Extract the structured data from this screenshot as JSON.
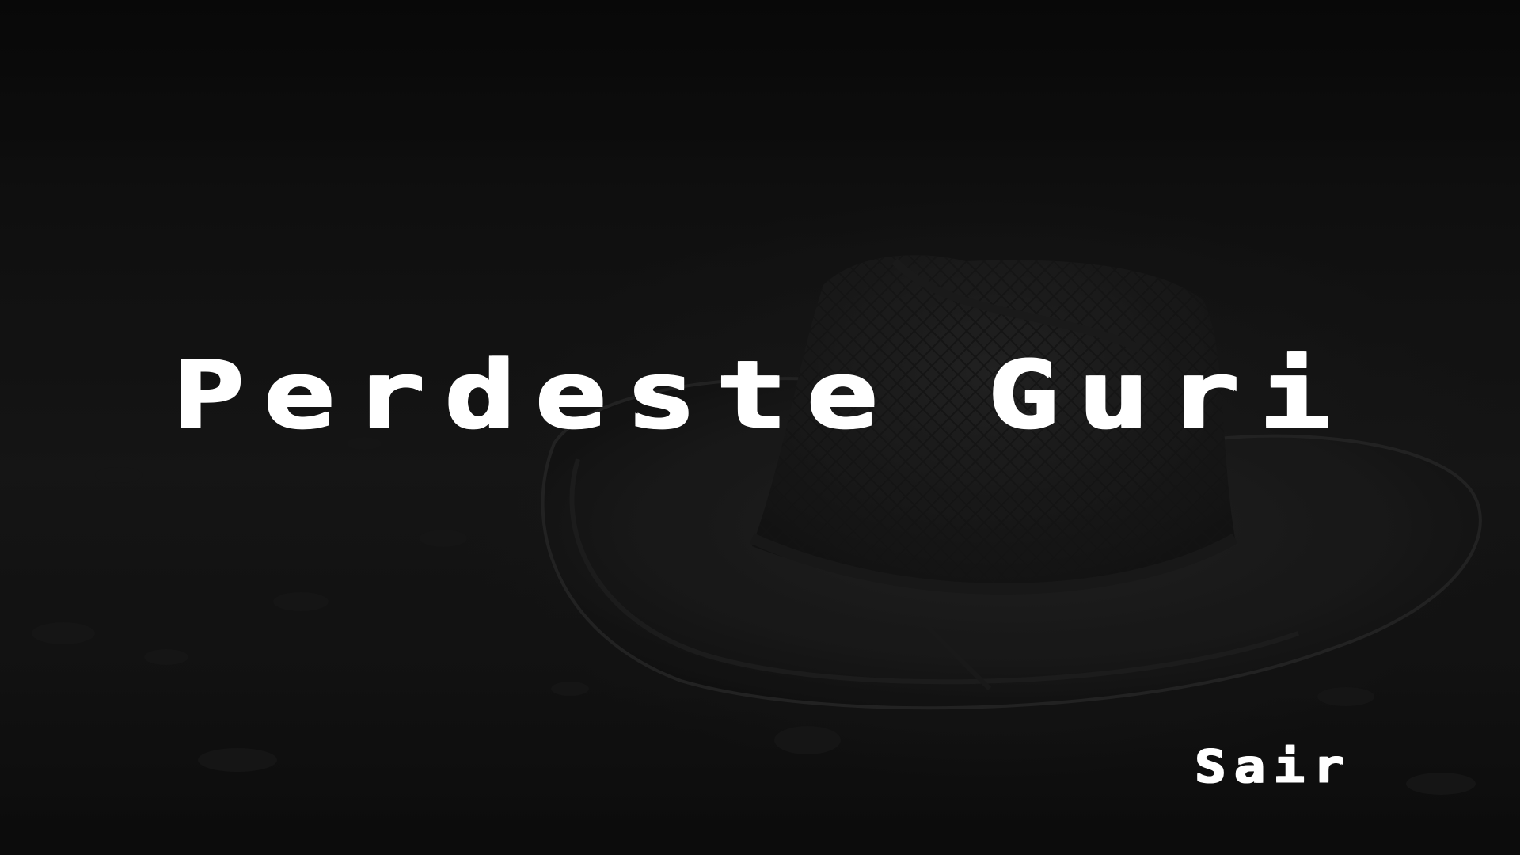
{
  "screen": {
    "title": "Perdeste Guri",
    "exit_label": "Sair"
  },
  "background": {
    "scene": "hat-on-ground",
    "tone": "dark"
  },
  "colors": {
    "text": "#ffffff",
    "background": "#141414"
  }
}
